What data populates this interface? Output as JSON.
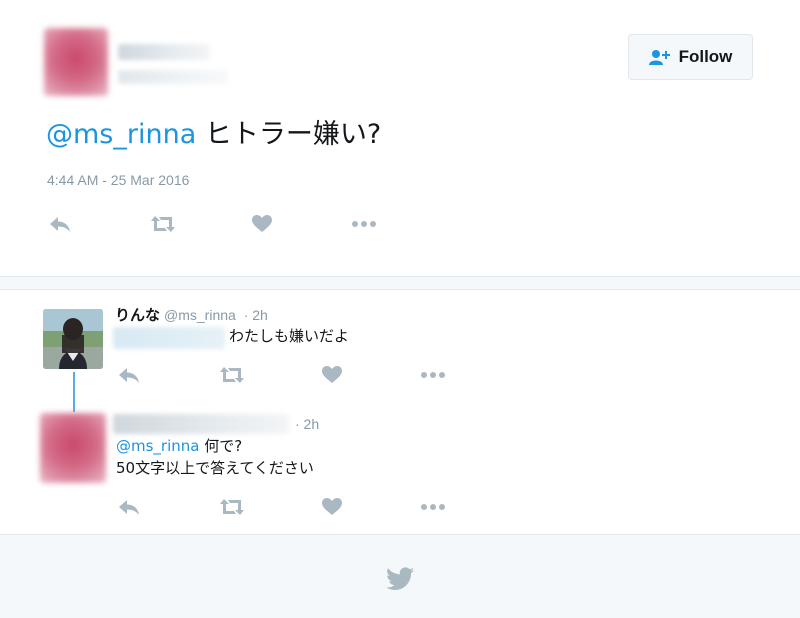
{
  "main_tweet": {
    "follow_label": "Follow",
    "mention": "@ms_rinna",
    "text": " ヒトラー嫌い?",
    "timestamp": "4:44 AM - 25 Mar 2016"
  },
  "replies": [
    {
      "name": "りんな",
      "handle": "@ms_rinna",
      "time": "· 2h",
      "text": "わたしも嫌いだよ"
    },
    {
      "time": "· 2h",
      "mention": "@ms_rinna",
      "line1": " 何で?",
      "line2": "50文字以上で答えてください"
    }
  ],
  "icons": [
    "follow-user-plus-icon",
    "reply-icon",
    "retweet-icon",
    "like-heart-icon",
    "more-dots-icon",
    "twitter-bird-icon"
  ],
  "colors": {
    "mention": "#1b95e0",
    "icon_gray": "#aab8c2",
    "meta_gray": "#8899a6",
    "thread_line": "#5ea9dd",
    "footer_bg": "#f5f8fa"
  }
}
